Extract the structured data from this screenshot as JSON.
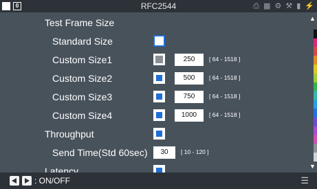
{
  "header": {
    "title": "RFC2544",
    "badge": "0"
  },
  "rows": [
    {
      "label": "Test Frame Size"
    },
    {
      "label": "Standard Size"
    },
    {
      "label": "Custom Size1",
      "value": "250",
      "range": "[ 64 - 1518 ]"
    },
    {
      "label": "Custom Size2",
      "value": "500",
      "range": "[ 64 - 1518 ]"
    },
    {
      "label": "Custom Size3",
      "value": "750",
      "range": "[ 64 - 1518 ]"
    },
    {
      "label": "Custom Size4",
      "value": "1000",
      "range": "[ 64 - 1518 ]"
    },
    {
      "label": "Throughput"
    },
    {
      "label": "Send Time(Std 60sec)",
      "value": "30",
      "range": "[ 10 - 120 ]"
    },
    {
      "label": "Latency"
    }
  ],
  "footer": {
    "hint": ": ON/OFF"
  },
  "colors": {
    "background": "#48525b",
    "bar": "#2c3238",
    "accent": "#1e6fd6"
  },
  "icons": [
    "printer-icon",
    "network-icon",
    "usb-icon",
    "tool-icon",
    "battery-icon",
    "power-plug-icon"
  ]
}
